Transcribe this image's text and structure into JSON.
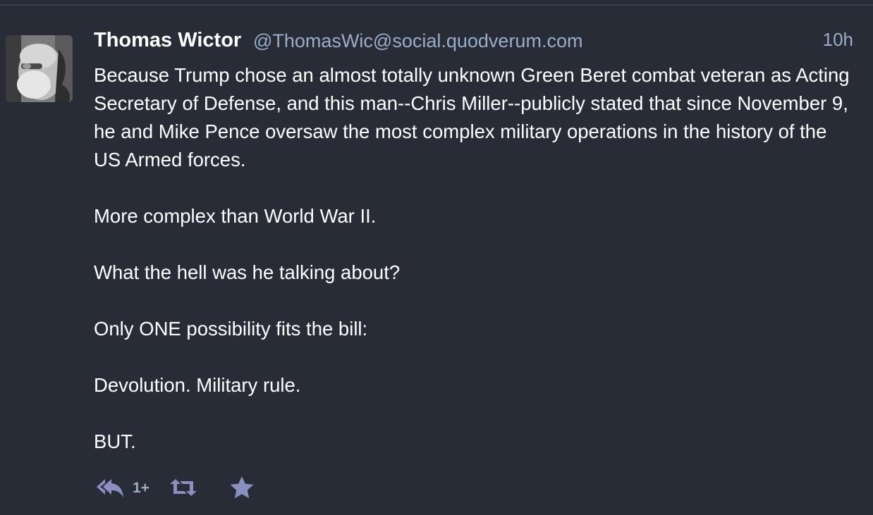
{
  "status": {
    "display_name": "Thomas Wictor",
    "handle": "@ThomasWic@social.quodverum.com",
    "time": "10h",
    "paragraphs": [
      "Because Trump chose an almost totally unknown Green Beret combat veteran as Acting Secretary of Defense, and this man--Chris Miller--publicly stated that since November 9, he and Mike Pence oversaw the most complex military operations in the history of the US Armed forces.",
      "More complex than World War II.",
      "What the hell was he talking about?",
      "Only ONE possibility fits the bill:",
      "Devolution. Military rule.",
      "BUT."
    ],
    "reply_count": "1+"
  },
  "icons": {
    "avatar": "avatar-image",
    "reply": "reply-all-icon",
    "boost": "retweet-icon",
    "favourite": "star-icon"
  },
  "colors": {
    "background": "#282c37",
    "text": "#ffffff",
    "secondary": "#9baec8",
    "icon": "#8a8fbf"
  }
}
